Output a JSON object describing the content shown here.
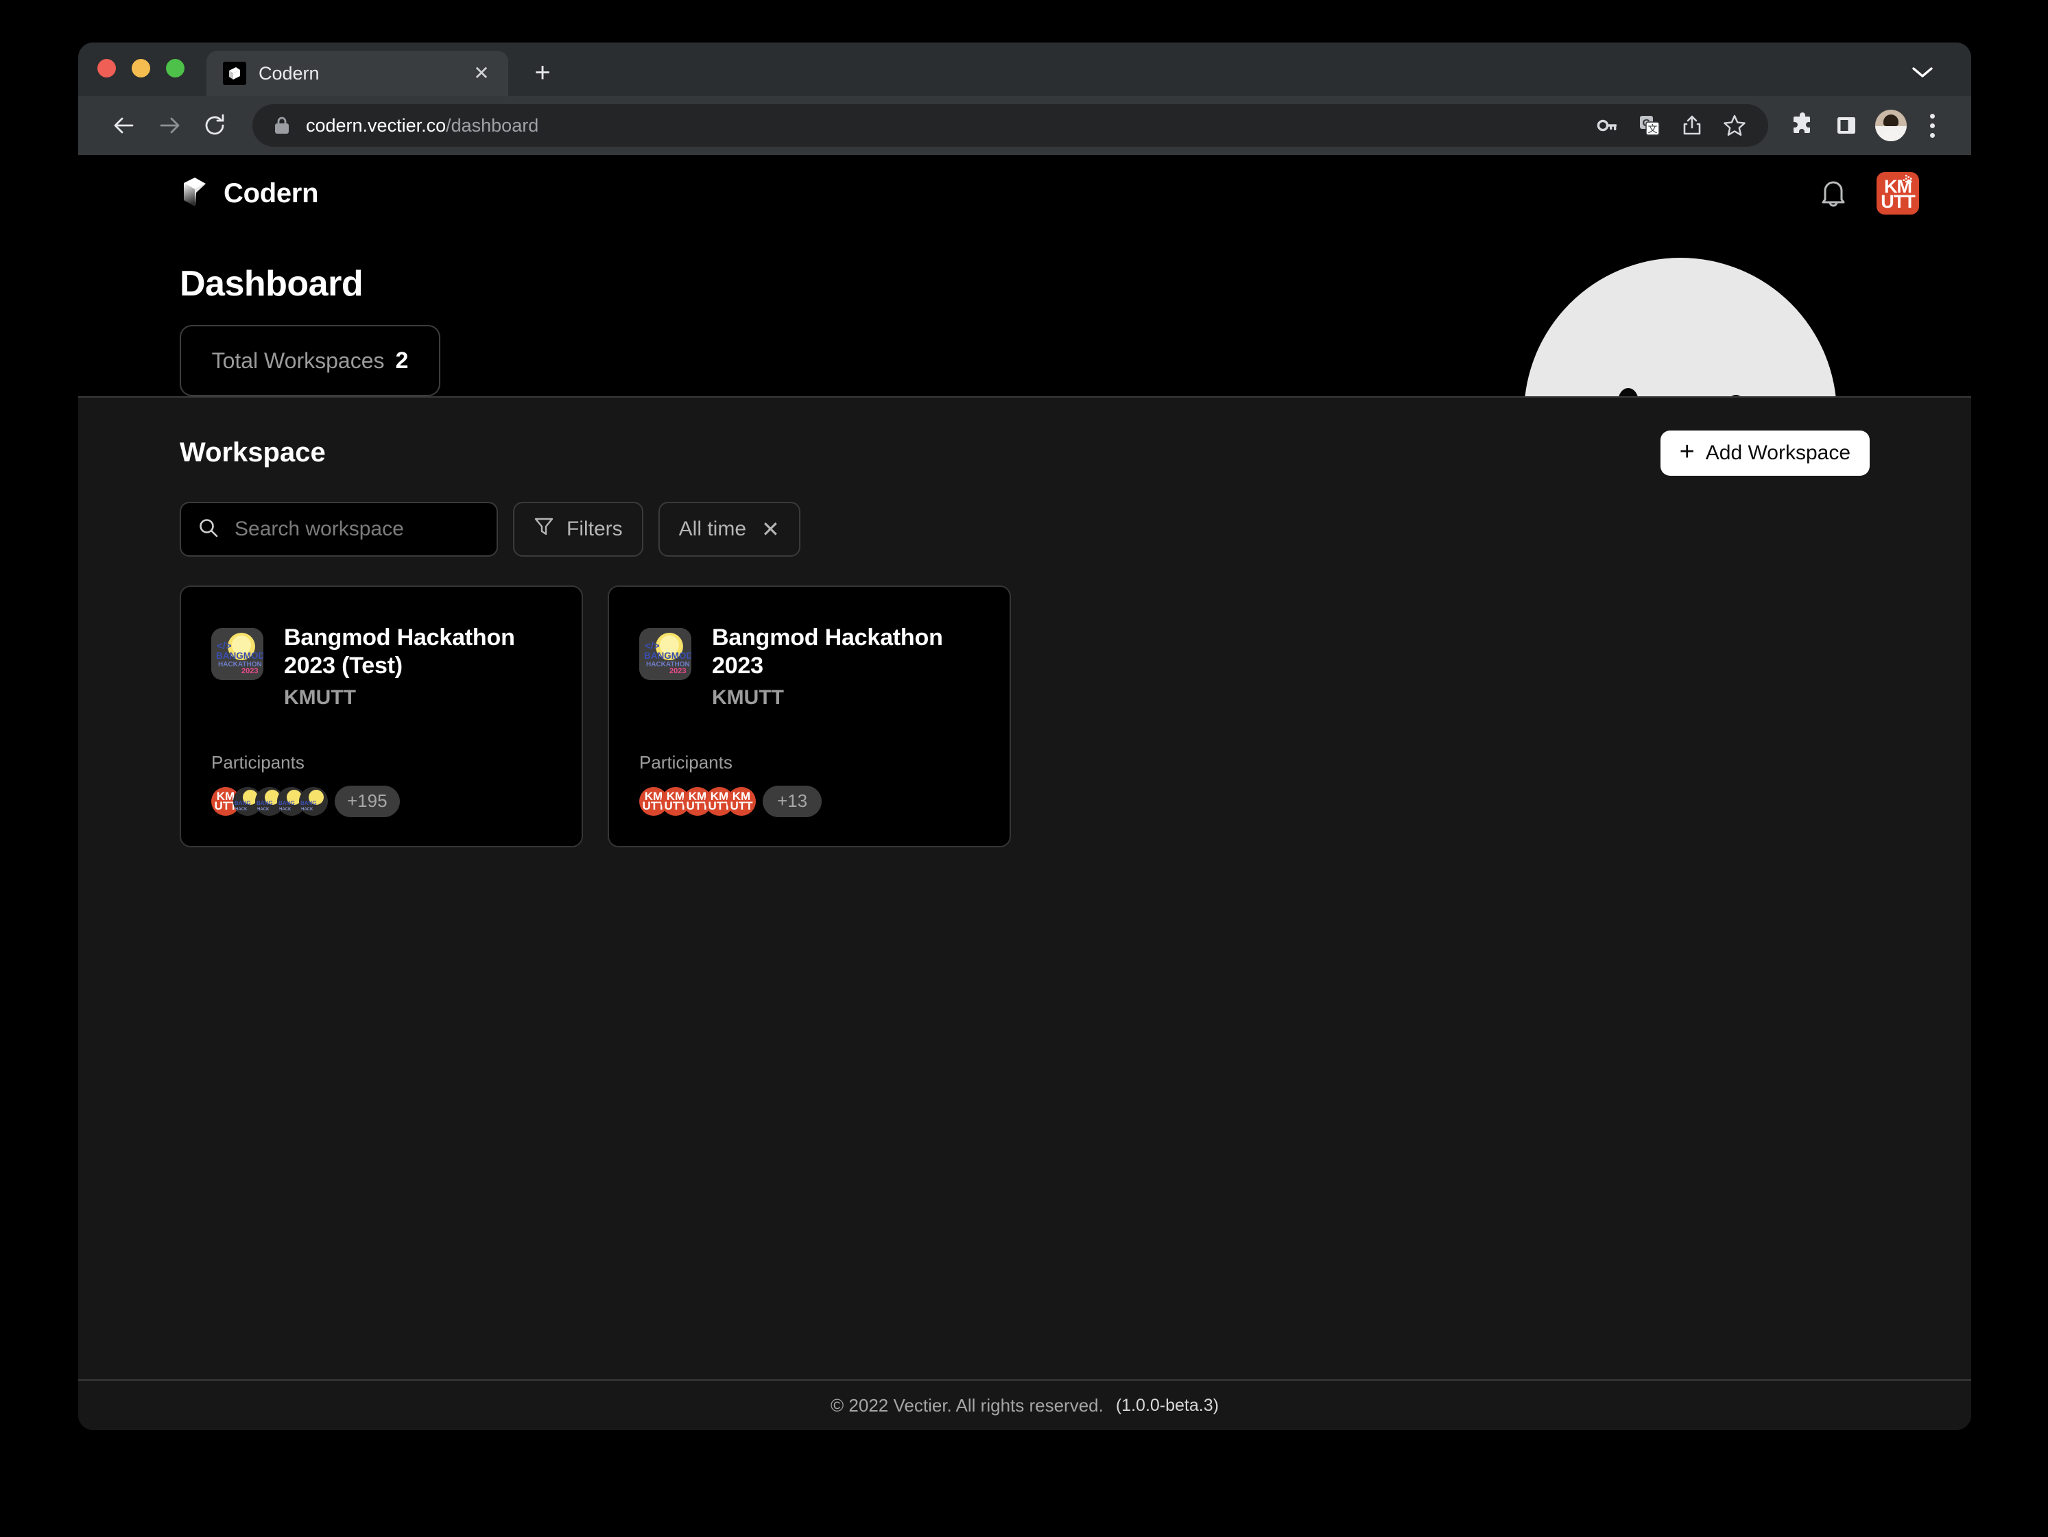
{
  "browser": {
    "tab": {
      "title": "Codern",
      "favicon_icon": "codern-logo-icon",
      "close_icon": "close-icon"
    },
    "new_tab_icon": "plus-icon",
    "tabstrip_chevron_icon": "chevron-down-icon",
    "nav": {
      "back_icon": "arrow-left-icon",
      "forward_icon": "arrow-right-icon",
      "reload_icon": "reload-icon"
    },
    "omnibox": {
      "lock_icon": "lock-icon",
      "host": "codern.vectier.co",
      "path": "/dashboard",
      "inline_icons": [
        "password-key-icon",
        "translate-icon",
        "share-icon",
        "bookmark-star-icon"
      ]
    },
    "toolbar_icons": [
      "extensions-puzzle-icon",
      "side-panel-icon"
    ],
    "profile_icon": "profile-avatar",
    "menu_icon": "kebab-menu-icon"
  },
  "app": {
    "brand": {
      "name": "Codern",
      "logo_icon": "codern-cube-logo-icon"
    },
    "header": {
      "notifications_icon": "bell-icon",
      "user_badge": {
        "label": "KM\nUTT",
        "color": "#d9472c"
      }
    }
  },
  "hero": {
    "title": "Dashboard",
    "stat": {
      "label": "Total Workspaces",
      "value": "2"
    },
    "mascot_icon": "smiley-face-mascot",
    "mascot_color": "#e8e8e8",
    "background": "#000000"
  },
  "workspace": {
    "section_title": "Workspace",
    "add_button": {
      "label": "Add Workspace",
      "icon": "plus-icon"
    },
    "search": {
      "placeholder": "Search workspace",
      "value": "",
      "icon": "search-icon"
    },
    "filters_chip": {
      "label": "Filters",
      "icon": "filter-funnel-icon"
    },
    "time_chip": {
      "label": "All time",
      "clear_icon": "close-x-icon"
    },
    "cards": [
      {
        "title": "Bangmod Hackathon 2023 (Test)",
        "org": "KMUTT",
        "icon": "bangmod-hackathon-2023-icon",
        "participants_label": "Participants",
        "avatars": [
          "kmutt",
          "bangmod",
          "bangmod",
          "bangmod",
          "bangmod"
        ],
        "more_count": "+195"
      },
      {
        "title": "Bangmod Hackathon 2023",
        "org": "KMUTT",
        "icon": "bangmod-hackathon-2023-icon",
        "participants_label": "Participants",
        "avatars": [
          "kmutt",
          "kmutt",
          "kmutt",
          "kmutt",
          "kmutt"
        ],
        "more_count": "+13"
      }
    ]
  },
  "footer": {
    "copyright": "© 2022 Vectier. All rights reserved.",
    "version": "(1.0.0-beta.3)"
  },
  "colors": {
    "page_background": "#171717",
    "hero_background": "#000000",
    "card_background": "#000000",
    "accent_orange": "#d9472c",
    "border": "#3a3a3a",
    "text_primary": "#ffffff",
    "text_muted": "#9d9d9d"
  }
}
